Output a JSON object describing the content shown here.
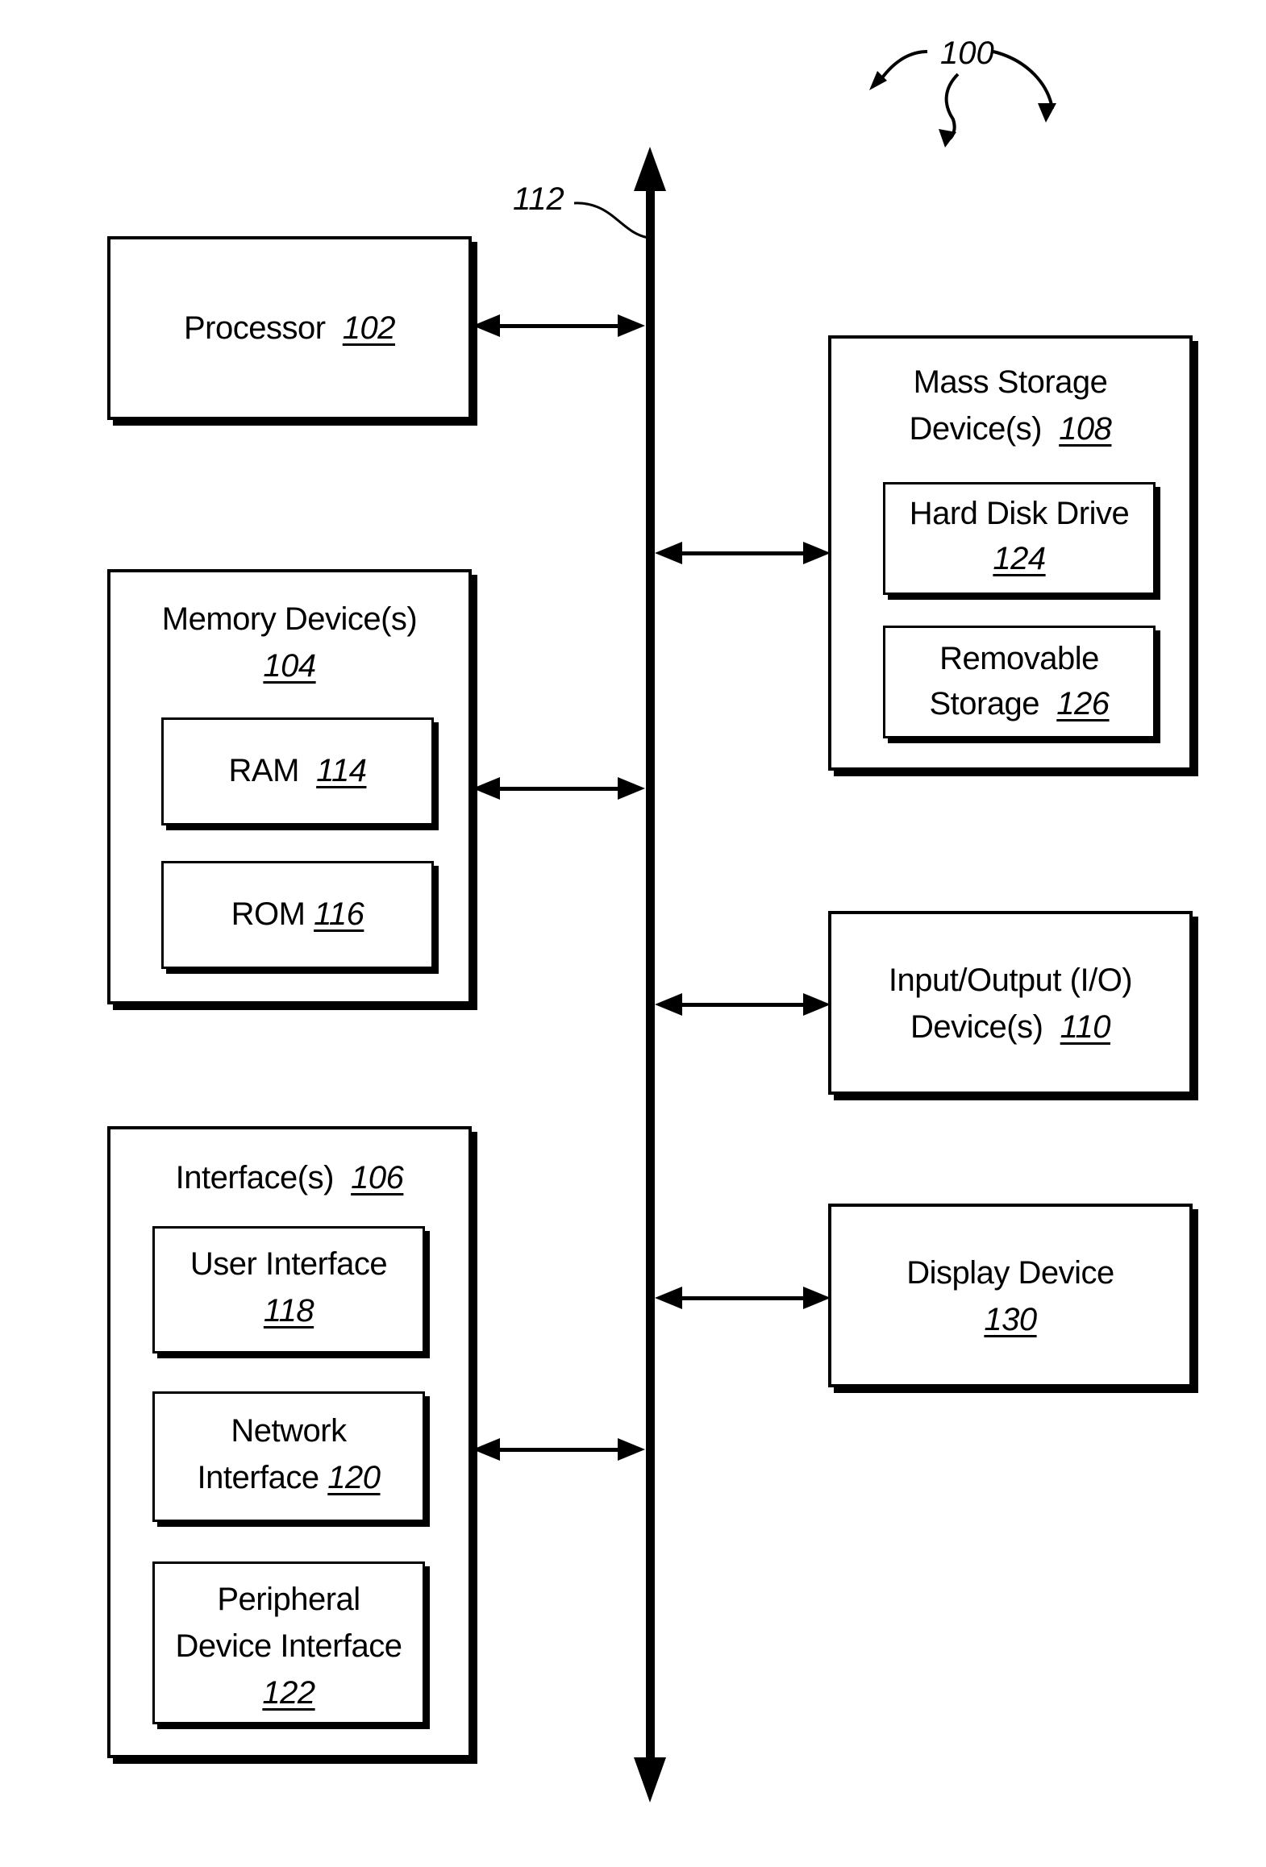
{
  "figure": {
    "ref": "100",
    "bus_ref": "112"
  },
  "processor": {
    "label": "Processor",
    "ref": "102"
  },
  "memory": {
    "label": "Memory Device(s)",
    "ref": "104",
    "ram": {
      "label": "RAM",
      "ref": "114"
    },
    "rom": {
      "label": "ROM",
      "ref": "116"
    }
  },
  "interfaces": {
    "label": "Interface(s)",
    "ref": "106",
    "user": {
      "label": "User Interface",
      "ref": "118"
    },
    "network": {
      "label_line1": "Network",
      "label_line2": "Interface",
      "ref": "120"
    },
    "peripheral": {
      "label_line1": "Peripheral",
      "label_line2": "Device Interface",
      "ref": "122"
    }
  },
  "mass_storage": {
    "label_line1": "Mass Storage",
    "label_line2": "Device(s)",
    "ref": "108",
    "hdd": {
      "label": "Hard Disk Drive",
      "ref": "124"
    },
    "removable": {
      "label_line1": "Removable",
      "label_line2": "Storage",
      "ref": "126"
    }
  },
  "io": {
    "label_line1": "Input/Output (I/O)",
    "label_line2": "Device(s)",
    "ref": "110"
  },
  "display": {
    "label": "Display Device",
    "ref": "130"
  }
}
